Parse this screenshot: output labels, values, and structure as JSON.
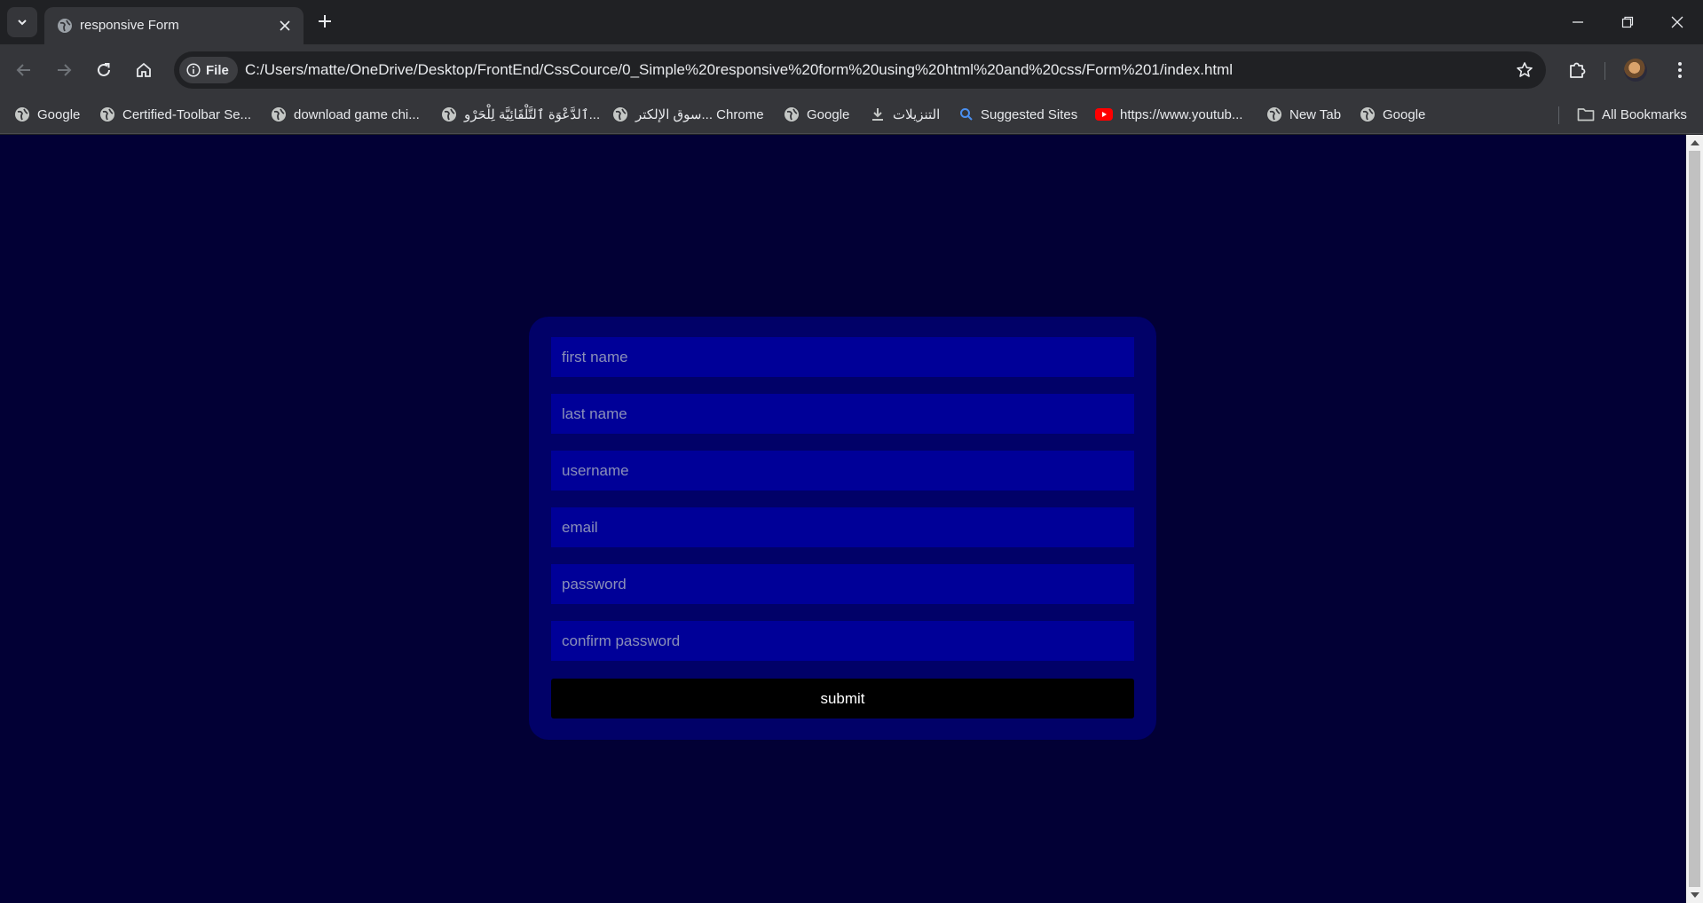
{
  "browser": {
    "tab": {
      "title": "responsive Form"
    },
    "address": {
      "scheme_chip": "File",
      "url": "C:/Users/matte/OneDrive/Desktop/FrontEnd/CssCource/0_Simple%20responsive%20form%20using%20html%20and%20css/Form%201/index.html"
    },
    "bookmarks": [
      {
        "label": "Google",
        "icon": "globe-icon"
      },
      {
        "label": "Certified-Toolbar Se...",
        "icon": "globe-icon"
      },
      {
        "label": "download game chi...",
        "icon": "globe-icon"
      },
      {
        "label": "ٱلدَّعْوَة ٱلتَّلْقَائِيَّة لِلْحَرْو...",
        "icon": "globe-icon"
      },
      {
        "label": "سوق الإلكتر... Chrome",
        "icon": "globe-icon"
      },
      {
        "label": "Google",
        "icon": "globe-icon"
      },
      {
        "label": "التنزيلات",
        "icon": "download-icon"
      },
      {
        "label": "Suggested Sites",
        "icon": "search-icon"
      },
      {
        "label": "https://www.youtub...",
        "icon": "youtube-icon"
      },
      {
        "label": "New Tab",
        "icon": "globe-icon"
      },
      {
        "label": "Google",
        "icon": "globe-icon"
      }
    ],
    "all_bookmarks": "All Bookmarks"
  },
  "form": {
    "fields": [
      {
        "placeholder": "first name"
      },
      {
        "placeholder": "last name"
      },
      {
        "placeholder": "username"
      },
      {
        "placeholder": "email"
      },
      {
        "placeholder": "password"
      },
      {
        "placeholder": "confirm password"
      }
    ],
    "submit_label": "submit"
  },
  "colors": {
    "page_background": "#020035",
    "card_background": "#010168",
    "field_background": "#000098",
    "button_background": "#000000"
  }
}
